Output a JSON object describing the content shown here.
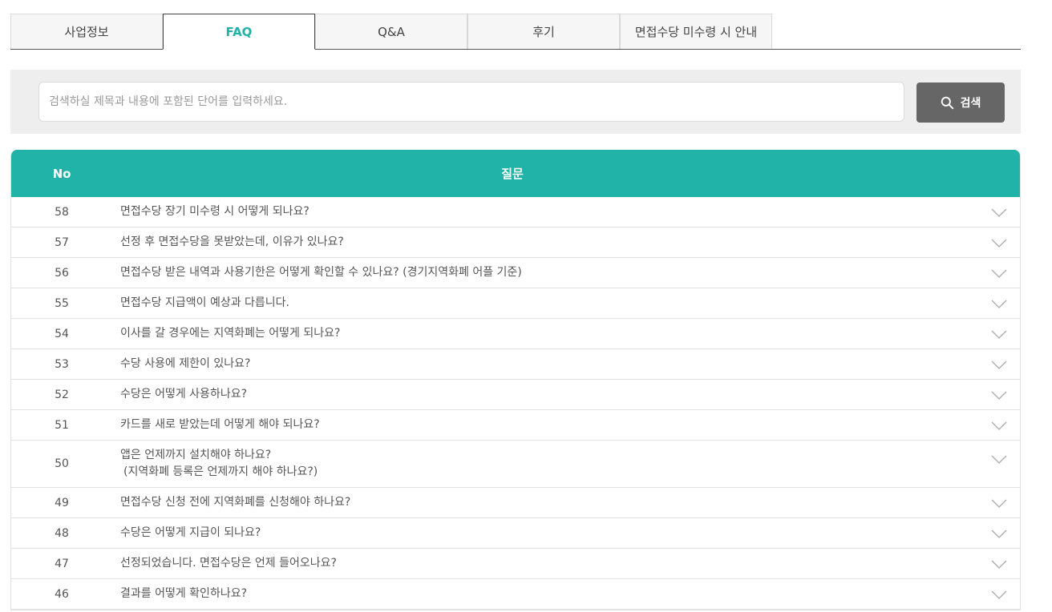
{
  "tabs": [
    {
      "label": "사업정보",
      "active": false
    },
    {
      "label": "FAQ",
      "active": true
    },
    {
      "label": "Q&A",
      "active": false
    },
    {
      "label": "후기",
      "active": false
    },
    {
      "label": "면접수당 미수령 시 안내",
      "active": false
    }
  ],
  "search": {
    "placeholder": "검색하실 제목과 내용에 포함된 단어를 입력하세요.",
    "value": "",
    "button_label": "검색",
    "button_icon": "search-icon"
  },
  "table": {
    "headers": {
      "no": "No",
      "question": "질문"
    },
    "rows": [
      {
        "no": "58",
        "question": "면접수당 장기 미수령 시 어떻게 되나요?",
        "sub": ""
      },
      {
        "no": "57",
        "question": "선정 후 면접수당을 못받았는데, 이유가 있나요?",
        "sub": ""
      },
      {
        "no": "56",
        "question": "면접수당 받은 내역과 사용기한은 어떻게 확인할 수 있나요? (경기지역화폐 어플 기준)",
        "sub": ""
      },
      {
        "no": "55",
        "question": "면접수당 지급액이 예상과 다릅니다.",
        "sub": ""
      },
      {
        "no": "54",
        "question": "이사를 갈 경우에는 지역화폐는 어떻게 되나요?",
        "sub": ""
      },
      {
        "no": "53",
        "question": "수당 사용에 제한이 있나요?",
        "sub": ""
      },
      {
        "no": "52",
        "question": "수당은 어떻게 사용하나요?",
        "sub": ""
      },
      {
        "no": "51",
        "question": "카드를 새로 받았는데 어떻게 해야 되나요?",
        "sub": ""
      },
      {
        "no": "50",
        "question": "앱은 언제까지 설치해야 하나요?",
        "sub": "(지역화폐 등록은 언제까지 해야 하나요?)"
      },
      {
        "no": "49",
        "question": "면접수당 신청 전에 지역화폐를 신청해야 하나요?",
        "sub": ""
      },
      {
        "no": "48",
        "question": "수당은 어떻게 지급이 되나요?",
        "sub": ""
      },
      {
        "no": "47",
        "question": "선정되었습니다. 면접수당은 언제 들어오나요?",
        "sub": ""
      },
      {
        "no": "46",
        "question": "결과를 어떻게 확인하나요?",
        "sub": ""
      }
    ],
    "row_icon": "chevron-down-icon"
  },
  "colors": {
    "accent": "#22b3a8",
    "search_button": "#666666",
    "search_bg": "#eeeeee"
  }
}
